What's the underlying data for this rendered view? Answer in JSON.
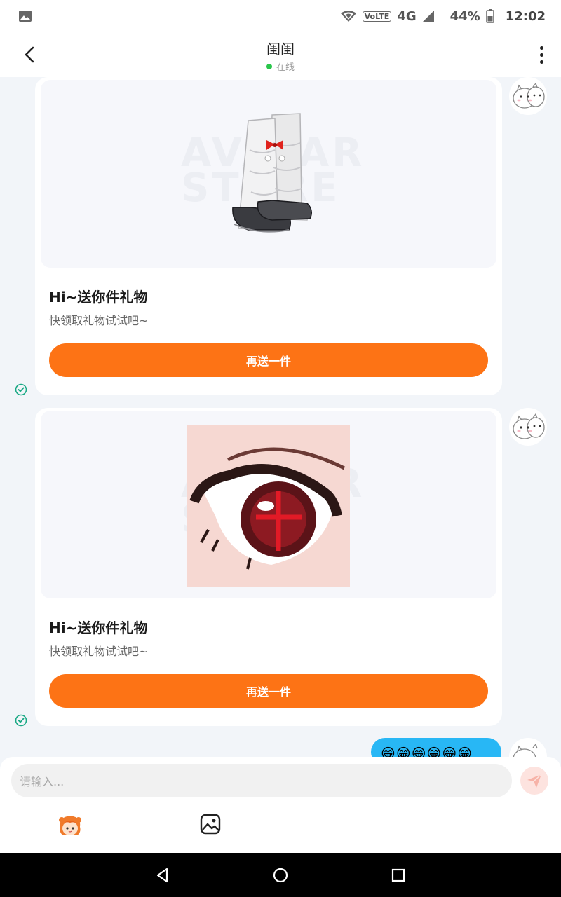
{
  "status_bar": {
    "network": "4G",
    "volte": "VoLTE",
    "battery": "44%",
    "time": "12:02"
  },
  "header": {
    "title": "闺闺",
    "status": "在线"
  },
  "messages": [
    {
      "title": "Hi~送你件礼物",
      "subtitle": "快领取礼物试试吧~",
      "button": "再送一件",
      "item": "white-leg-warmers-shoes"
    },
    {
      "title": "Hi~送你件礼物",
      "subtitle": "快领取礼物试试吧~",
      "button": "再送一件",
      "item": "red-eye"
    }
  ],
  "outgoing_bubble": "😁😁😁😁😁😁",
  "watermark": "AVATAR STORE",
  "input": {
    "placeholder": "请输入..."
  },
  "colors": {
    "accent": "#fd7315",
    "bubble": "#28b7f5",
    "online": "#2ac64b"
  }
}
